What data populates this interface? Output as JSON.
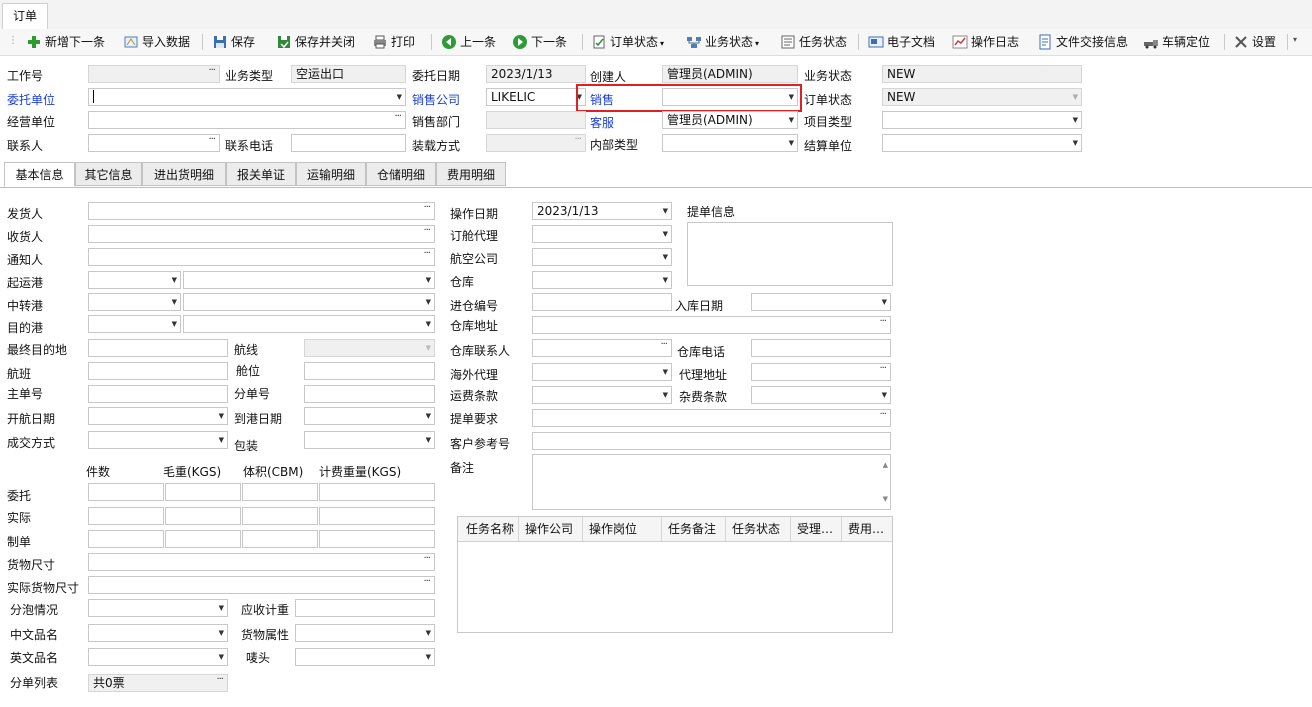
{
  "window": {
    "tab_label": "订单"
  },
  "toolbar": {
    "new_next": "新增下一条",
    "import_data": "导入数据",
    "save": "保存",
    "save_close": "保存并关闭",
    "print": "打印",
    "prev": "上一条",
    "next": "下一条",
    "order_status": "订单状态",
    "business_status": "业务状态",
    "task_status": "任务状态",
    "e_docs": "电子文档",
    "op_log": "操作日志",
    "file_handover": "文件交接信息",
    "vehicle_locate": "车辆定位",
    "settings": "设置"
  },
  "header": {
    "job_no_label": "工作号",
    "job_no_value": "",
    "biz_type_label": "业务类型",
    "biz_type_value": "空运出口",
    "entrust_date_label": "委托日期",
    "entrust_date_value": "2023/1/13",
    "creator_label": "创建人",
    "creator_value": "管理员(ADMIN)",
    "biz_status_label": "业务状态",
    "biz_status_value": "NEW",
    "client_label": "委托单位",
    "client_value": "",
    "sales_company_label": "销售公司",
    "sales_company_value": "LIKELIC",
    "sales_label": "销售",
    "sales_value": "",
    "order_status_label": "订单状态",
    "order_status_value": "NEW",
    "operating_unit_label": "经营单位",
    "operating_unit_value": "",
    "sales_dept_label": "销售部门",
    "sales_dept_value": "",
    "cs_label": "客服",
    "cs_value": "管理员(ADMIN)",
    "project_type_label": "项目类型",
    "project_type_value": "",
    "contact_label": "联系人",
    "contact_value": "",
    "phone_label": "联系电话",
    "phone_value": "",
    "loading_label": "装载方式",
    "loading_value": "",
    "internal_type_label": "内部类型",
    "internal_type_value": "",
    "settle_unit_label": "结算单位",
    "settle_unit_value": ""
  },
  "tabs": [
    "基本信息",
    "其它信息",
    "进出货明细",
    "报关单证",
    "运输明细",
    "仓储明细",
    "费用明细"
  ],
  "basic": {
    "shipper": "发货人",
    "consignee": "收货人",
    "notify": "通知人",
    "pol": "起运港",
    "transit": "中转港",
    "pod": "目的港",
    "final_dest": "最终目的地",
    "route": "航线",
    "flight": "航班",
    "space": "舱位",
    "mawb": "主单号",
    "hawb": "分单号",
    "etd": "开航日期",
    "eta": "到港日期",
    "deal_type": "成交方式",
    "packing": "包装",
    "col_pieces": "件数",
    "col_gross": "毛重(KGS)",
    "col_volume": "体积(CBM)",
    "col_charge": "计费重量(KGS)",
    "row_entrust": "委托",
    "row_actual": "实际",
    "row_made": "制单",
    "cargo_size": "货物尺寸",
    "actual_cargo_size": "实际货物尺寸",
    "bubble": "分泡情况",
    "receivable_weight": "应收计重",
    "cn_name": "中文品名",
    "cargo_attr": "货物属性",
    "en_name": "英文品名",
    "mark": "唛头",
    "sub_list": "分单列表",
    "sub_list_value": "共0票"
  },
  "right": {
    "op_date_label": "操作日期",
    "op_date_value": "2023/1/13",
    "bl_info_label": "提单信息",
    "booking_agent": "订舱代理",
    "airline": "航空公司",
    "warehouse": "仓库",
    "in_no": "进仓编号",
    "in_date": "入库日期",
    "wh_address": "仓库地址",
    "wh_contact": "仓库联系人",
    "wh_phone": "仓库电话",
    "overseas_agent": "海外代理",
    "agent_address": "代理地址",
    "freight_terms": "运费条款",
    "misc_terms": "杂费条款",
    "bl_requirement": "提单要求",
    "customer_ref": "客户参考号",
    "remark": "备注"
  },
  "task_grid": {
    "columns": [
      "任务名称",
      "操作公司",
      "操作岗位",
      "任务备注",
      "任务状态",
      "受理…",
      "费用…"
    ]
  },
  "highlight_color": "#e02020"
}
